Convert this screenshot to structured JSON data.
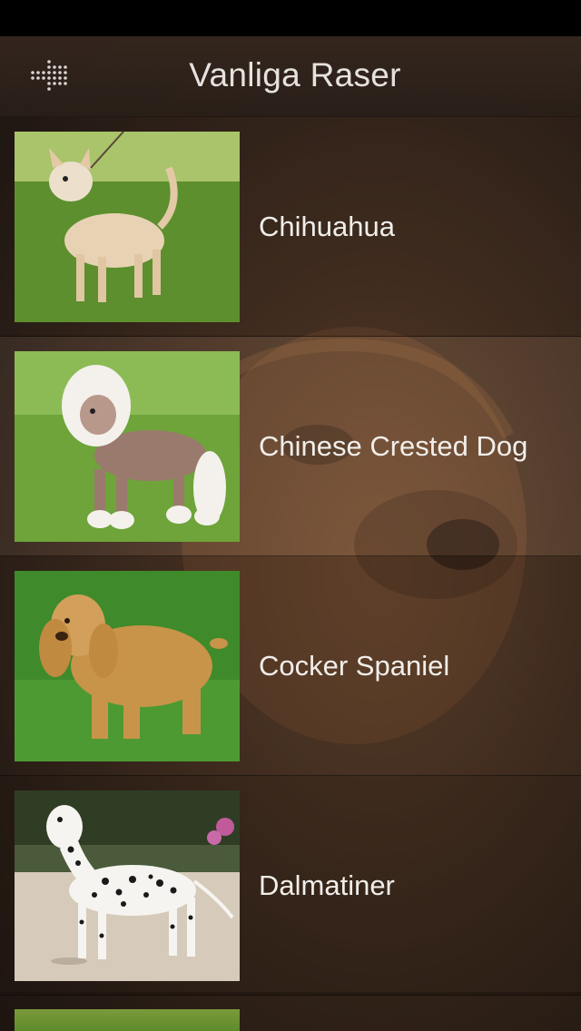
{
  "nav": {
    "title": "Vanliga Raser",
    "menu_icon": "menu-grid-icon"
  },
  "breeds": [
    {
      "name": "Chihuahua",
      "image": "chihuahua-photo"
    },
    {
      "name": "Chinese Crested Dog",
      "image": "chinese-crested-photo"
    },
    {
      "name": "Cocker Spaniel",
      "image": "cocker-spaniel-photo"
    },
    {
      "name": "Dalmatiner",
      "image": "dalmatian-photo"
    }
  ],
  "colors": {
    "background": "#4a3324",
    "nav_bar": "#34261e",
    "text": "#f1eeea"
  }
}
